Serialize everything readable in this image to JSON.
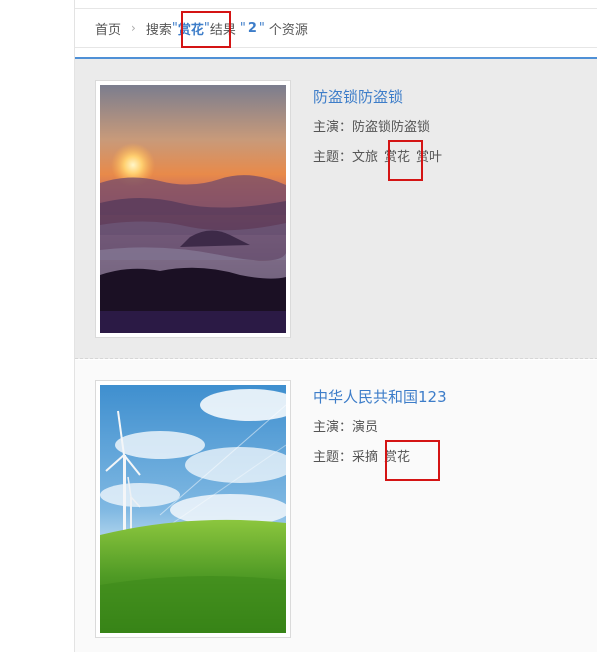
{
  "breadcrumb": {
    "home": "首页",
    "search_prefix": "搜索",
    "open_quote": "\"",
    "keyword": "赏花",
    "close_quote": "\"",
    "result_text": "结果",
    "count_open": "\"",
    "count": "2",
    "count_close": "\"",
    "suffix": "个资源"
  },
  "results": [
    {
      "title": "防盗锁防盗锁",
      "actor_label": "主演：",
      "actor": "防盗锁防盗锁",
      "theme_label": "主题：",
      "tags": [
        "文旅",
        "赏花",
        "赏叶"
      ],
      "image": "sunset-mountains-image"
    },
    {
      "title": "中华人民共和国123",
      "actor_label": "主演：",
      "actor": "演员",
      "theme_label": "主题：",
      "tags": [
        "采摘",
        "赏花"
      ],
      "image": "wind-turbine-field-image"
    }
  ],
  "colors": {
    "link": "#3d7dc9",
    "highlight_border": "#d41414",
    "accent_line": "#4f90d6"
  }
}
